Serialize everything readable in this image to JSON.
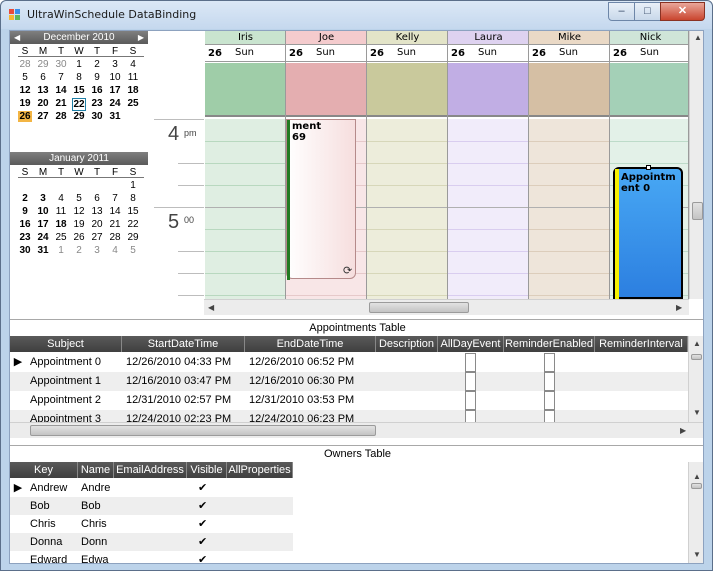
{
  "window": {
    "title": "UltraWinSchedule DataBinding",
    "minimize": "–",
    "maximize": "□",
    "close": "✕"
  },
  "calendar": {
    "months": [
      {
        "title": "December 2010",
        "days_of_week": [
          "S",
          "M",
          "T",
          "W",
          "T",
          "F",
          "S"
        ],
        "weeks": [
          [
            "28",
            "29",
            "30",
            "1",
            "2",
            "3",
            "4"
          ],
          [
            "5",
            "6",
            "7",
            "8",
            "9",
            "10",
            "11"
          ],
          [
            "12",
            "13",
            "14",
            "15",
            "16",
            "17",
            "18"
          ],
          [
            "19",
            "20",
            "21",
            "22",
            "23",
            "24",
            "25"
          ],
          [
            "26",
            "27",
            "28",
            "29",
            "30",
            "31",
            ""
          ]
        ],
        "prev_arrow": "◀",
        "next_arrow": "▶"
      },
      {
        "title": "January 2011",
        "days_of_week": [
          "S",
          "M",
          "T",
          "W",
          "T",
          "F",
          "S"
        ],
        "weeks": [
          [
            "",
            "",
            "",
            "",
            "",
            "",
            "1"
          ],
          [
            "2",
            "3",
            "4",
            "5",
            "6",
            "7",
            "8"
          ],
          [
            "9",
            "10",
            "11",
            "12",
            "13",
            "14",
            "15"
          ],
          [
            "16",
            "17",
            "18",
            "19",
            "20",
            "21",
            "22"
          ],
          [
            "23",
            "24",
            "25",
            "26",
            "27",
            "28",
            "29"
          ],
          [
            "30",
            "31",
            "1",
            "2",
            "3",
            "4",
            "5"
          ]
        ]
      }
    ]
  },
  "schedule": {
    "time_labels": [
      {
        "hour": "4",
        "suffix": "pm"
      },
      {
        "hour": "5",
        "suffix": "00"
      }
    ],
    "day_number": "26",
    "day_name": "Sun",
    "owners": [
      {
        "name": "Iris",
        "header": "#c9e4cf",
        "allday": "#9fcda8",
        "body": "#dfeee2",
        "line": "#b8d8bf"
      },
      {
        "name": "Joe",
        "header": "#f4cbcd",
        "allday": "#e4aeb0",
        "body": "#f8e6e7",
        "line": "#e6c9ca"
      },
      {
        "name": "Kelly",
        "header": "#e3e4c8",
        "allday": "#c9c99c",
        "body": "#ededdb",
        "line": "#d7d7b9"
      },
      {
        "name": "Laura",
        "header": "#ded2f0",
        "allday": "#c1aee4",
        "body": "#f1ecfa",
        "line": "#d9cdef"
      },
      {
        "name": "Mike",
        "header": "#ead9c6",
        "allday": "#d5bfa4",
        "body": "#eee5da",
        "line": "#dccdbb"
      },
      {
        "name": "Nick",
        "header": "#cfe5d8",
        "allday": "#a4d0b7",
        "body": "#e3f1e8",
        "line": "#bddbc9"
      }
    ],
    "appointment_joe": {
      "line1": "ment",
      "line2": "69",
      "recur_icon": "⟳"
    },
    "appointment_nick": {
      "line1": "Appointm",
      "line2": "ent 0"
    }
  },
  "appointments_table": {
    "title": "Appointments Table",
    "columns": [
      "Subject",
      "StartDateTime",
      "EndDateTime",
      "Description",
      "AllDayEvent",
      "ReminderEnabled",
      "ReminderInterval"
    ],
    "rows": [
      {
        "subject": "Appointment 0",
        "start": "12/26/2010 04:33 PM",
        "end": "12/26/2010 06:52 PM"
      },
      {
        "subject": "Appointment 1",
        "start": "12/16/2010 03:47 PM",
        "end": "12/16/2010 06:30 PM"
      },
      {
        "subject": "Appointment 2",
        "start": "12/31/2010 02:57 PM",
        "end": "12/31/2010 03:53 PM"
      },
      {
        "subject": "Appointment 3",
        "start": "12/24/2010 02:23 PM",
        "end": "12/24/2010 06:23 PM"
      }
    ],
    "row_selector": "▶"
  },
  "owners_table": {
    "title": "Owners Table",
    "columns": [
      "Key",
      "Name",
      "EmailAddress",
      "Visible",
      "AllProperties"
    ],
    "rows": [
      {
        "key": "Andrew",
        "name": "Andre",
        "visible": "✔"
      },
      {
        "key": "Bob",
        "name": "Bob",
        "visible": "✔"
      },
      {
        "key": "Chris",
        "name": "Chris",
        "visible": "✔"
      },
      {
        "key": "Donna",
        "name": "Donn",
        "visible": "✔"
      },
      {
        "key": "Edward",
        "name": "Edwa",
        "visible": "✔"
      }
    ],
    "row_selector": "▶"
  },
  "scroll": {
    "up": "▲",
    "down": "▼",
    "left": "◀",
    "right": "▶"
  },
  "colors": {
    "today": "#f3b544",
    "selected_border": "#1e7fa6",
    "appt_blue": "#2c7fe0",
    "appt_bar_yellow": "#f5f000",
    "appt_bar_green": "#227a22"
  }
}
